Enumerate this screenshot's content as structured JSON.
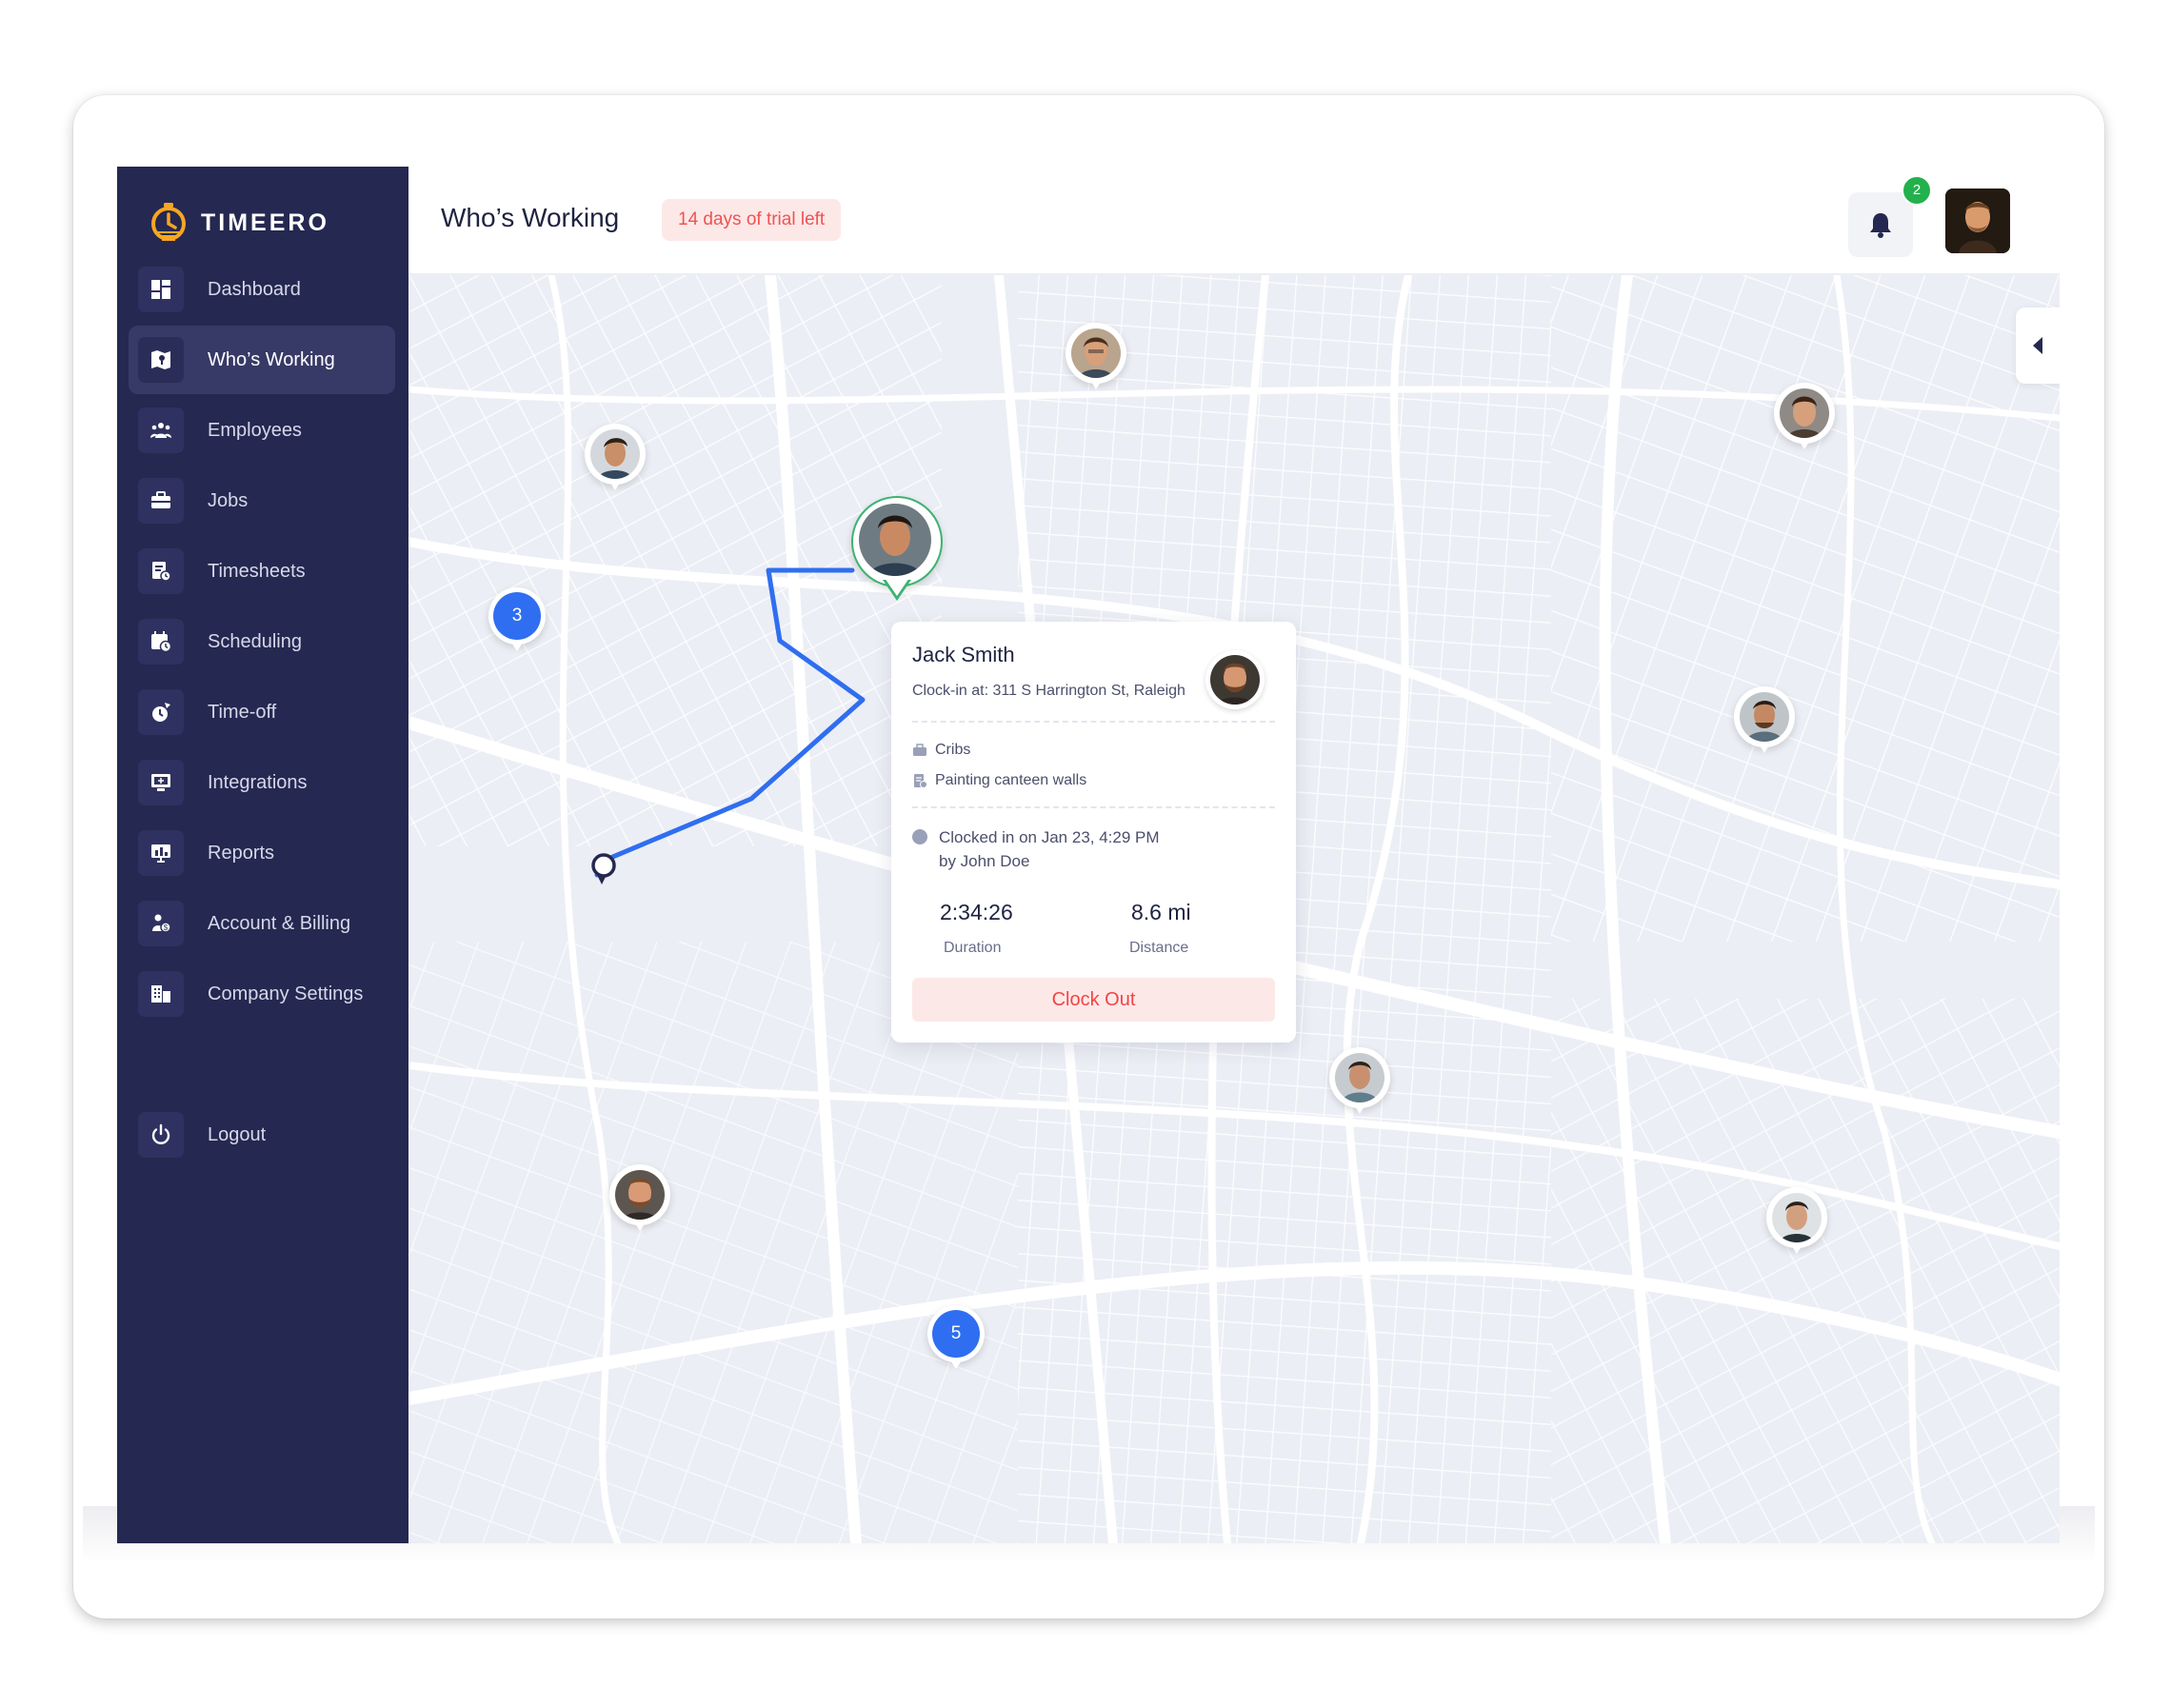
{
  "app": {
    "brand": "TIMEERO",
    "page_title": "Who’s Working",
    "trial_badge": "14 days of trial left",
    "notification_count": "2",
    "colors": {
      "sidebar": "#252850",
      "accent": "#2f6ef0",
      "danger": "#f05252",
      "success": "#22b14c"
    }
  },
  "sidebar": {
    "items": [
      {
        "label": "Dashboard",
        "icon": "dashboard-icon"
      },
      {
        "label": "Who’s Working",
        "icon": "map-icon",
        "active": true
      },
      {
        "label": "Employees",
        "icon": "team-icon"
      },
      {
        "label": "Jobs",
        "icon": "briefcase-icon"
      },
      {
        "label": "Timesheets",
        "icon": "timesheet-icon"
      },
      {
        "label": "Scheduling",
        "icon": "calendar-clock-icon"
      },
      {
        "label": "Time-off",
        "icon": "time-off-icon"
      },
      {
        "label": "Integrations",
        "icon": "integrations-icon"
      },
      {
        "label": "Reports",
        "icon": "reports-icon"
      },
      {
        "label": "Account & Billing",
        "icon": "billing-icon"
      },
      {
        "label": "Company Settings",
        "icon": "building-icon"
      }
    ],
    "logout": {
      "label": "Logout",
      "icon": "power-icon"
    }
  },
  "map": {
    "clusters": [
      {
        "count": "3"
      },
      {
        "count": "5"
      }
    ]
  },
  "card": {
    "name": "Jack Smith",
    "address": "Clock-in at: 311 S Harrington St, Raleigh",
    "job": "Cribs",
    "task": "Painting canteen walls",
    "clocked_line1": "Clocked in on Jan 23, 4:29 PM",
    "clocked_line2": "by John Doe",
    "duration_value": "2:34:26",
    "duration_label": "Duration",
    "distance_value": "8.6 mi",
    "distance_label": "Distance",
    "clock_out_label": "Clock Out"
  }
}
